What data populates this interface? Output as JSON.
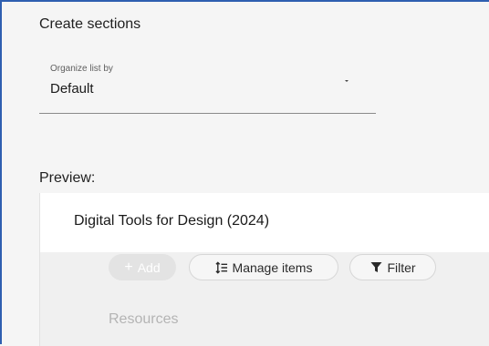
{
  "create_sections": {
    "title": "Create sections"
  },
  "organize": {
    "label": "Organize list by",
    "value": "Default"
  },
  "preview": {
    "label": "Preview:",
    "card_title": "Digital Tools for Design (2024)",
    "add_label": "Add",
    "manage_label": "Manage items",
    "filter_label": "Filter",
    "section_label": "Resources"
  }
}
